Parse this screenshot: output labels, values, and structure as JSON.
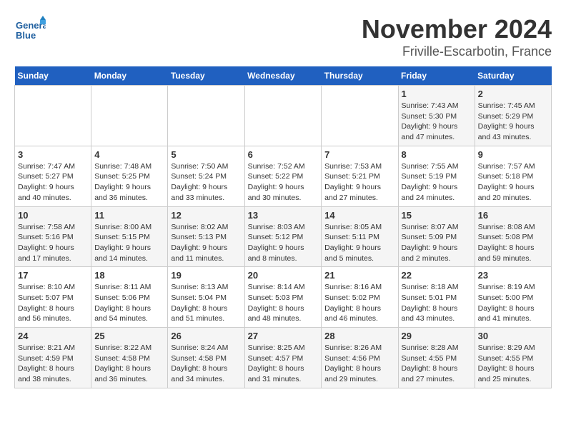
{
  "logo": {
    "line1": "General",
    "line2": "Blue"
  },
  "title": "November 2024",
  "subtitle": "Friville-Escarbotin, France",
  "days_header": [
    "Sunday",
    "Monday",
    "Tuesday",
    "Wednesday",
    "Thursday",
    "Friday",
    "Saturday"
  ],
  "weeks": [
    [
      {
        "day": "",
        "info": ""
      },
      {
        "day": "",
        "info": ""
      },
      {
        "day": "",
        "info": ""
      },
      {
        "day": "",
        "info": ""
      },
      {
        "day": "",
        "info": ""
      },
      {
        "day": "1",
        "info": "Sunrise: 7:43 AM\nSunset: 5:30 PM\nDaylight: 9 hours\nand 47 minutes."
      },
      {
        "day": "2",
        "info": "Sunrise: 7:45 AM\nSunset: 5:29 PM\nDaylight: 9 hours\nand 43 minutes."
      }
    ],
    [
      {
        "day": "3",
        "info": "Sunrise: 7:47 AM\nSunset: 5:27 PM\nDaylight: 9 hours\nand 40 minutes."
      },
      {
        "day": "4",
        "info": "Sunrise: 7:48 AM\nSunset: 5:25 PM\nDaylight: 9 hours\nand 36 minutes."
      },
      {
        "day": "5",
        "info": "Sunrise: 7:50 AM\nSunset: 5:24 PM\nDaylight: 9 hours\nand 33 minutes."
      },
      {
        "day": "6",
        "info": "Sunrise: 7:52 AM\nSunset: 5:22 PM\nDaylight: 9 hours\nand 30 minutes."
      },
      {
        "day": "7",
        "info": "Sunrise: 7:53 AM\nSunset: 5:21 PM\nDaylight: 9 hours\nand 27 minutes."
      },
      {
        "day": "8",
        "info": "Sunrise: 7:55 AM\nSunset: 5:19 PM\nDaylight: 9 hours\nand 24 minutes."
      },
      {
        "day": "9",
        "info": "Sunrise: 7:57 AM\nSunset: 5:18 PM\nDaylight: 9 hours\nand 20 minutes."
      }
    ],
    [
      {
        "day": "10",
        "info": "Sunrise: 7:58 AM\nSunset: 5:16 PM\nDaylight: 9 hours\nand 17 minutes."
      },
      {
        "day": "11",
        "info": "Sunrise: 8:00 AM\nSunset: 5:15 PM\nDaylight: 9 hours\nand 14 minutes."
      },
      {
        "day": "12",
        "info": "Sunrise: 8:02 AM\nSunset: 5:13 PM\nDaylight: 9 hours\nand 11 minutes."
      },
      {
        "day": "13",
        "info": "Sunrise: 8:03 AM\nSunset: 5:12 PM\nDaylight: 9 hours\nand 8 minutes."
      },
      {
        "day": "14",
        "info": "Sunrise: 8:05 AM\nSunset: 5:11 PM\nDaylight: 9 hours\nand 5 minutes."
      },
      {
        "day": "15",
        "info": "Sunrise: 8:07 AM\nSunset: 5:09 PM\nDaylight: 9 hours\nand 2 minutes."
      },
      {
        "day": "16",
        "info": "Sunrise: 8:08 AM\nSunset: 5:08 PM\nDaylight: 8 hours\nand 59 minutes."
      }
    ],
    [
      {
        "day": "17",
        "info": "Sunrise: 8:10 AM\nSunset: 5:07 PM\nDaylight: 8 hours\nand 56 minutes."
      },
      {
        "day": "18",
        "info": "Sunrise: 8:11 AM\nSunset: 5:06 PM\nDaylight: 8 hours\nand 54 minutes."
      },
      {
        "day": "19",
        "info": "Sunrise: 8:13 AM\nSunset: 5:04 PM\nDaylight: 8 hours\nand 51 minutes."
      },
      {
        "day": "20",
        "info": "Sunrise: 8:14 AM\nSunset: 5:03 PM\nDaylight: 8 hours\nand 48 minutes."
      },
      {
        "day": "21",
        "info": "Sunrise: 8:16 AM\nSunset: 5:02 PM\nDaylight: 8 hours\nand 46 minutes."
      },
      {
        "day": "22",
        "info": "Sunrise: 8:18 AM\nSunset: 5:01 PM\nDaylight: 8 hours\nand 43 minutes."
      },
      {
        "day": "23",
        "info": "Sunrise: 8:19 AM\nSunset: 5:00 PM\nDaylight: 8 hours\nand 41 minutes."
      }
    ],
    [
      {
        "day": "24",
        "info": "Sunrise: 8:21 AM\nSunset: 4:59 PM\nDaylight: 8 hours\nand 38 minutes."
      },
      {
        "day": "25",
        "info": "Sunrise: 8:22 AM\nSunset: 4:58 PM\nDaylight: 8 hours\nand 36 minutes."
      },
      {
        "day": "26",
        "info": "Sunrise: 8:24 AM\nSunset: 4:58 PM\nDaylight: 8 hours\nand 34 minutes."
      },
      {
        "day": "27",
        "info": "Sunrise: 8:25 AM\nSunset: 4:57 PM\nDaylight: 8 hours\nand 31 minutes."
      },
      {
        "day": "28",
        "info": "Sunrise: 8:26 AM\nSunset: 4:56 PM\nDaylight: 8 hours\nand 29 minutes."
      },
      {
        "day": "29",
        "info": "Sunrise: 8:28 AM\nSunset: 4:55 PM\nDaylight: 8 hours\nand 27 minutes."
      },
      {
        "day": "30",
        "info": "Sunrise: 8:29 AM\nSunset: 4:55 PM\nDaylight: 8 hours\nand 25 minutes."
      }
    ]
  ]
}
